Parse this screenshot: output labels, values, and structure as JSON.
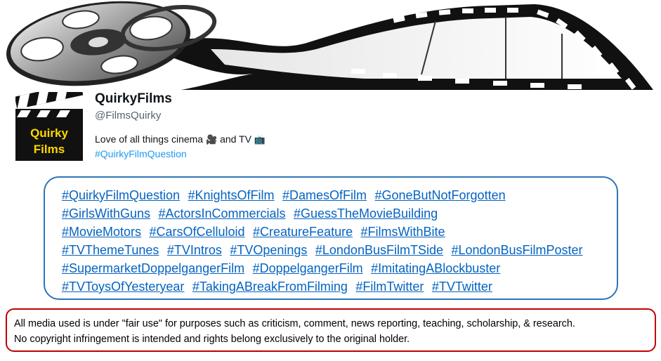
{
  "profile": {
    "name": "QuirkyFilms",
    "handle": "@FilmsQuirky",
    "bio_text": "Love of all things cinema",
    "bio_and": "and TV",
    "bio_hashtag": "#QuirkyFilmQuestion",
    "avatar_text_line1": "Quirky",
    "avatar_text_line2": "Films"
  },
  "hashtag_lines": [
    [
      "#QuirkyFilmQuestion",
      "#KnightsOfFilm",
      "#DamesOfFilm",
      "#GoneButNotForgotten"
    ],
    [
      "#GirlsWithGuns",
      "#ActorsInCommercials",
      "#GuessTheMovieBuilding"
    ],
    [
      "#MovieMotors",
      "#CarsOfCelluloid",
      "#CreatureFeature",
      "#FilmsWithBite"
    ],
    [
      "#TVThemeTunes",
      "#TVIntros",
      "#TVOpenings",
      "#LondonBusFilmTSide",
      "#LondonBusFilmPoster"
    ],
    [
      "#SupermarketDoppelgangerFilm",
      "#DoppelgangerFilm",
      "#ImitatingABlockbuster"
    ],
    [
      "#TVToysOfYesteryear",
      "#TakingABreakFromFilming",
      "#FilmTwitter",
      "#TVTwitter"
    ]
  ],
  "notice": {
    "line1": "All media used is under \"fair use\" for purposes such as criticism, comment, news reporting, teaching, scholarship, & research.",
    "line2": "No copyright infringement is intended and rights belong exclusively to the original holder."
  },
  "icons": {
    "banner": "film-reel-and-strip",
    "bio_emoji_1": "movie-camera-icon",
    "bio_emoji_2": "television-icon"
  },
  "colors": {
    "link": "#0563c1",
    "twitter_blue": "#1d9bf0",
    "box_border": "#2e75b6",
    "notice_border": "#c00000",
    "avatar_text": "#ffd700"
  }
}
